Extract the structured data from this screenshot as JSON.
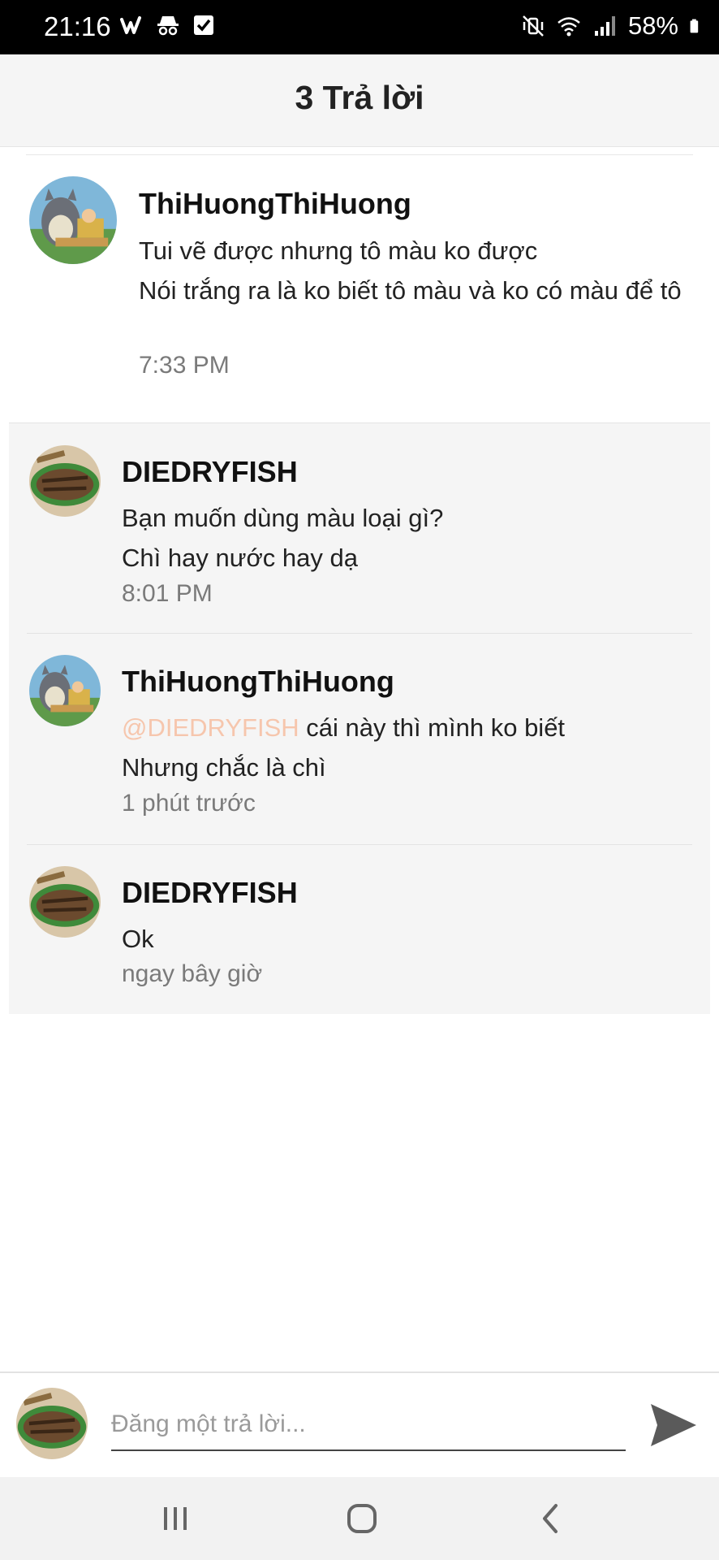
{
  "status_bar": {
    "time": "21:16",
    "battery": "58%",
    "left_icons": [
      "wattpad-icon",
      "incognito-icon",
      "checkbox-icon"
    ],
    "right_icons": [
      "mute-vibrate-icon",
      "wifi-icon",
      "signal-icon",
      "battery-icon"
    ]
  },
  "header": {
    "title": "3 Trả lời"
  },
  "thread": {
    "original": {
      "author": "ThiHuongThiHuong",
      "lines": [
        "Tui vẽ được nhưng tô màu ko được",
        "Nói trắng ra là ko biết tô màu và ko có màu để tô"
      ],
      "time": "7:33 PM"
    },
    "replies": [
      {
        "author": "DIEDRYFISH",
        "lines": [
          "Bạn muốn dùng màu loại gì?",
          "Chì hay nước hay dạ"
        ],
        "time": "8:01 PM"
      },
      {
        "author": "ThiHuongThiHuong",
        "mention": "@DIEDRYFISH",
        "line1_rest": " cái này thì mình ko biết",
        "line2": "Nhưng chắc là chì",
        "time": "1 phút trước"
      },
      {
        "author": "DIEDRYFISH",
        "lines": [
          "Ok"
        ],
        "time": "ngay bây giờ"
      }
    ]
  },
  "composer": {
    "placeholder": "Đăng một trả lời...",
    "value": ""
  },
  "nav_bar": {
    "buttons": [
      "recent-apps-icon",
      "home-icon",
      "back-icon"
    ]
  },
  "colors": {
    "mention": "#f6c6ad",
    "replies_bg": "#f5f5f5",
    "header_bg": "#f5f5f5",
    "nav_bg": "#f2f2f2"
  }
}
